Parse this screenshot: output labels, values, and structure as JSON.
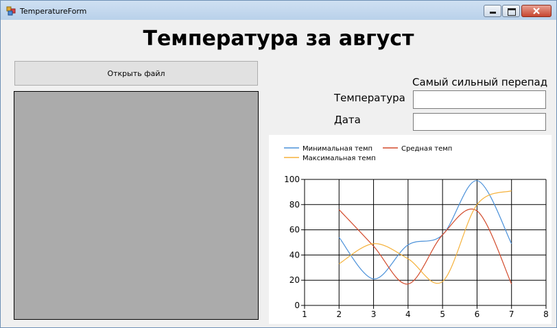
{
  "window": {
    "title": "TemperatureForm"
  },
  "heading": "Температура за август",
  "open_button": "Открыть файл",
  "drop_group_title": "Самый сильный перепад",
  "temperature_label": "Температура",
  "date_label": "Дата",
  "temperature_value": "",
  "date_value": "",
  "chart_data": {
    "type": "line",
    "title": "",
    "xlabel": "",
    "ylabel": "",
    "xlim": [
      1,
      8
    ],
    "ylim": [
      0,
      100
    ],
    "x_ticks": [
      1,
      2,
      3,
      4,
      5,
      6,
      7,
      8
    ],
    "y_ticks": [
      0,
      20,
      40,
      60,
      80,
      100
    ],
    "grid": true,
    "legend_position": "top-left",
    "series": [
      {
        "name": "Минимальная темп",
        "color": "#4a90d9",
        "x": [
          2,
          3,
          4,
          5,
          6,
          7
        ],
        "y": [
          54,
          21,
          48,
          56,
          99,
          49
        ]
      },
      {
        "name": "Средная темп",
        "color": "#d2492a",
        "x": [
          2,
          3,
          4,
          5,
          6,
          7
        ],
        "y": [
          76,
          47,
          17,
          56,
          75,
          17
        ]
      },
      {
        "name": "Максимальная темп",
        "color": "#f5b13a",
        "x": [
          2,
          3,
          4,
          5,
          6,
          7
        ],
        "y": [
          33,
          49,
          37,
          19,
          80,
          91
        ]
      }
    ]
  }
}
